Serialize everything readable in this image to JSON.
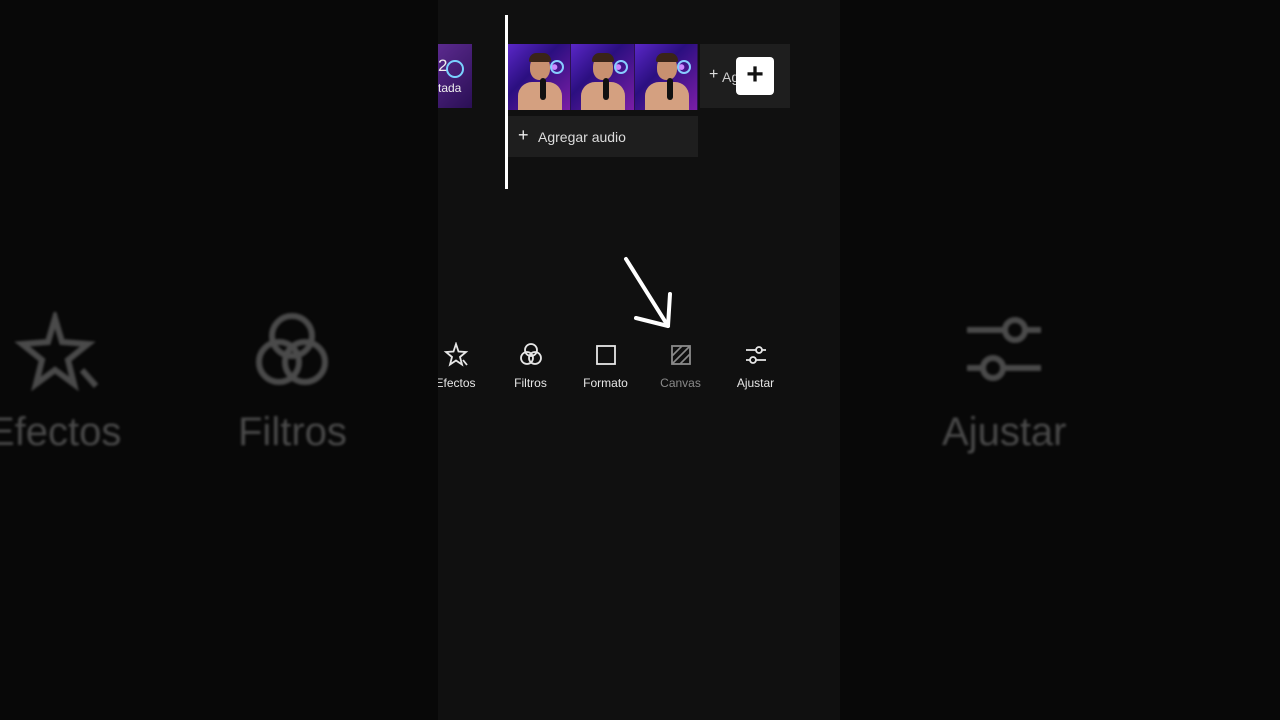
{
  "timeline": {
    "prev_clip_number": "2",
    "prev_clip_label": "tada",
    "add_clip_label": "Agregar",
    "add_audio_label": "Agregar audio"
  },
  "toolbar": {
    "items": [
      {
        "label": "Efectos",
        "icon": "effects-star-icon"
      },
      {
        "label": "Filtros",
        "icon": "filters-circles-icon"
      },
      {
        "label": "Formato",
        "icon": "format-square-icon"
      },
      {
        "label": "Canvas",
        "icon": "canvas-hatched-icon"
      },
      {
        "label": "Ajustar",
        "icon": "adjust-sliders-icon"
      }
    ]
  },
  "background": {
    "left_items": [
      "Efectos",
      "Filtros"
    ],
    "right_items": [
      "Ajustar"
    ]
  },
  "colors": {
    "background": "#050505",
    "panel": "#101010",
    "accent_clip": "#5a27c7",
    "playhead": "#ffffff"
  }
}
